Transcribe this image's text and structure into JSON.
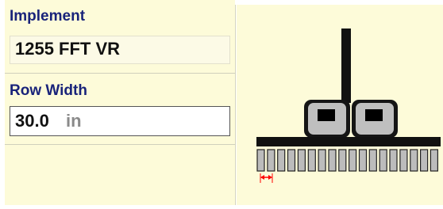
{
  "implement": {
    "label": "Implement",
    "value": "1255 FFT VR"
  },
  "row_width": {
    "label": "Row Width",
    "value": "30.0",
    "unit": "in"
  },
  "diagram": {
    "row_unit_count": 18,
    "accent_color": "#ff0000"
  }
}
